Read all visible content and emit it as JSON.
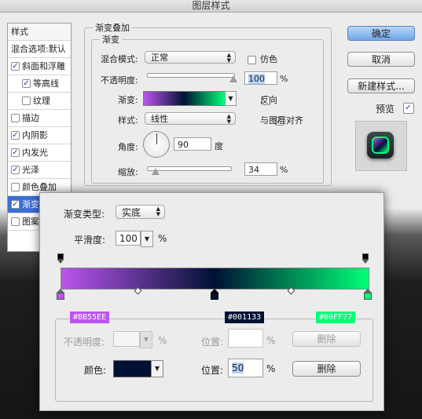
{
  "window": {
    "title": "图层样式"
  },
  "styles_list": {
    "header": "样式",
    "blend_options": "混合选项:默认",
    "items": [
      {
        "label": "斜面和浮雕",
        "checked": true,
        "indent": false
      },
      {
        "label": "等高线",
        "checked": true,
        "indent": true
      },
      {
        "label": "纹理",
        "checked": false,
        "indent": true
      },
      {
        "label": "描边",
        "checked": false,
        "indent": false
      },
      {
        "label": "内阴影",
        "checked": true,
        "indent": false
      },
      {
        "label": "内发光",
        "checked": true,
        "indent": false
      },
      {
        "label": "光泽",
        "checked": true,
        "indent": false
      },
      {
        "label": "颜色叠加",
        "checked": false,
        "indent": false
      },
      {
        "label": "渐变",
        "checked": true,
        "indent": false,
        "selected": true
      },
      {
        "label": "图案",
        "checked": false,
        "indent": false
      }
    ]
  },
  "gradient_overlay": {
    "group_title": "渐变叠加",
    "subgroup_title": "渐变",
    "blend_mode_label": "混合模式:",
    "blend_mode_value": "正常",
    "dither_label": "仿色",
    "opacity_label": "不透明度:",
    "opacity_value": "100",
    "opacity_unit": "%",
    "opacity_level": 1.0,
    "gradient_label": "渐变:",
    "reverse_label": "反向",
    "style_label": "样式:",
    "style_value": "线性",
    "align_label": "与图层对齐",
    "angle_label": "角度:",
    "angle_value": "90",
    "angle_unit": "度",
    "scale_label": "缩放:",
    "scale_value": "34",
    "scale_unit": "%",
    "scale_level": 0.34
  },
  "buttons": {
    "ok": "确定",
    "cancel": "取消",
    "new_style": "新建样式...",
    "preview": "预览"
  },
  "gradient_editor": {
    "type_label": "渐变类型:",
    "type_value": "实底",
    "smoothness_label": "平滑度:",
    "smoothness_value": "100",
    "smoothness_unit": "%",
    "color_stops": [
      {
        "hex": "#BB55EE",
        "location": 0
      },
      {
        "hex": "#001133",
        "location": 50
      },
      {
        "hex": "#00FF77",
        "location": 100
      }
    ],
    "tags": {
      "left": "#BB55EE",
      "mid": "#001133",
      "right": "#00FF77"
    },
    "stops_section": {
      "opacity_label": "不透明度:",
      "opacity_unit": "%",
      "opacity_location_label": "位置:",
      "opacity_location_unit": "%",
      "opacity_delete": "删除",
      "color_label": "颜色:",
      "color_swatch": "#001133",
      "location_label": "位置:",
      "location_value": "50",
      "location_unit": "%",
      "color_delete": "删除"
    }
  }
}
